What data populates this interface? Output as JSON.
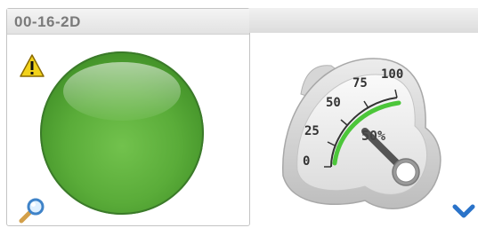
{
  "panel": {
    "title": "00-16-2D"
  },
  "status_indicator": {
    "color": "#5aac39",
    "state_color_name": "green"
  },
  "icons": {
    "warning": "warning-triangle-icon",
    "zoom": "magnifier-icon",
    "expand": "chevron-down-icon"
  },
  "gauge": {
    "min": 0,
    "max": 100,
    "value": 50,
    "value_label": "50%",
    "ticks": [
      "0",
      "25",
      "50",
      "75",
      "100"
    ],
    "arc_color": "#4cc63a"
  }
}
